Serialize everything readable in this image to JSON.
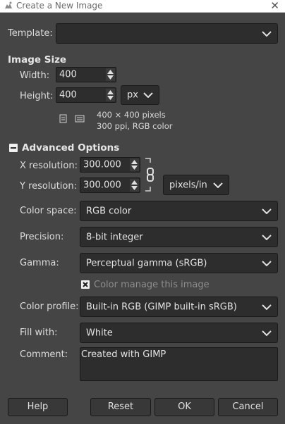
{
  "window": {
    "title": "Create a New Image",
    "close_symbol": "✕"
  },
  "template": {
    "label": "Template:",
    "value": ""
  },
  "image_size": {
    "section_title": "Image Size",
    "width_label": "Width:",
    "width_value": "400",
    "height_label": "Height:",
    "height_value": "400",
    "unit": "px",
    "info_line1": "400 × 400 pixels",
    "info_line2": "300 ppi, RGB color"
  },
  "advanced": {
    "section_title": "Advanced Options",
    "x_res_label": "X resolution:",
    "x_res_value": "300.000",
    "y_res_label": "Y resolution:",
    "y_res_value": "300.000",
    "res_unit": "pixels/in",
    "color_space_label": "Color space:",
    "color_space_value": "RGB color",
    "precision_label": "Precision:",
    "precision_value": "8-bit integer",
    "gamma_label": "Gamma:",
    "gamma_value": "Perceptual gamma (sRGB)",
    "color_manage_label": "Color manage this image",
    "color_manage_checked": true,
    "color_profile_label": "Color profile:",
    "color_profile_value": "Built-in RGB (GIMP built-in sRGB)",
    "fill_label": "Fill with:",
    "fill_value": "White",
    "comment_label": "Comment:",
    "comment_value": "Created with GIMP"
  },
  "buttons": {
    "help": "Help",
    "reset": "Reset",
    "ok": "OK",
    "cancel": "Cancel"
  },
  "colors": {
    "background": "#454545",
    "field": "#2d2d2d"
  }
}
